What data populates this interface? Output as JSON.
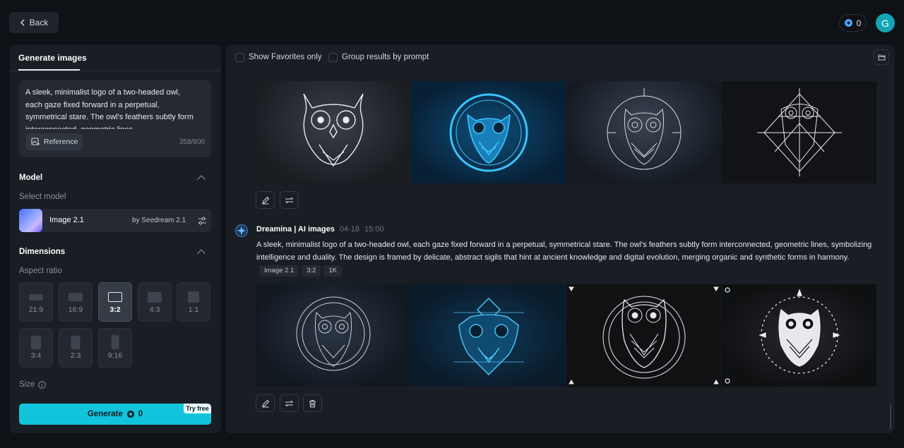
{
  "header": {
    "back_label": "Back",
    "credits": "0",
    "avatar_letter": "G"
  },
  "left_panel": {
    "tab_label": "Generate images",
    "prompt_text": "A sleek, minimalist logo of a two-headed owl, each gaze fixed forward in a perpetual, symmetrical stare. The owl's feathers subtly form interconnected, geometric lines,",
    "reference_label": "Reference",
    "char_count": "358/800",
    "model_section": "Model",
    "select_model_label": "Select model",
    "model_name": "Image 2.1",
    "model_by": "by Seedream 2.1",
    "dimensions_section": "Dimensions",
    "aspect_ratio_label": "Aspect ratio",
    "aspect_ratios": [
      "21:9",
      "16:9",
      "3:2",
      "4:3",
      "1:1",
      "3:4",
      "2:3",
      "9:16"
    ],
    "selected_ratio": "3:2",
    "size_label": "Size",
    "generate_label": "Generate",
    "generate_cost": "0",
    "try_free_label": "Try free"
  },
  "right_panel": {
    "show_favorites_label": "Show Favorites only",
    "group_by_prompt_label": "Group results by prompt",
    "generation": {
      "author": "Dreamina | AI images",
      "date": "04-18",
      "time": "15:00",
      "description": "A sleek, minimalist logo of a two-headed owl, each gaze fixed forward in a perpetual, symmetrical stare. The owl's feathers subtly form interconnected, geometric lines, symbolizing intelligence and duality. The design is framed by delicate, abstract sigils that hint at ancient knowledge and digital evolution, merging organic and synthetic forms in harmony.",
      "tags": [
        "Image 2.1",
        "3:2",
        "1K"
      ]
    }
  },
  "colors": {
    "accent": "#11c4dc",
    "avatar": "#12a4b4",
    "panel": "#191d24",
    "background": "#0e1116"
  }
}
